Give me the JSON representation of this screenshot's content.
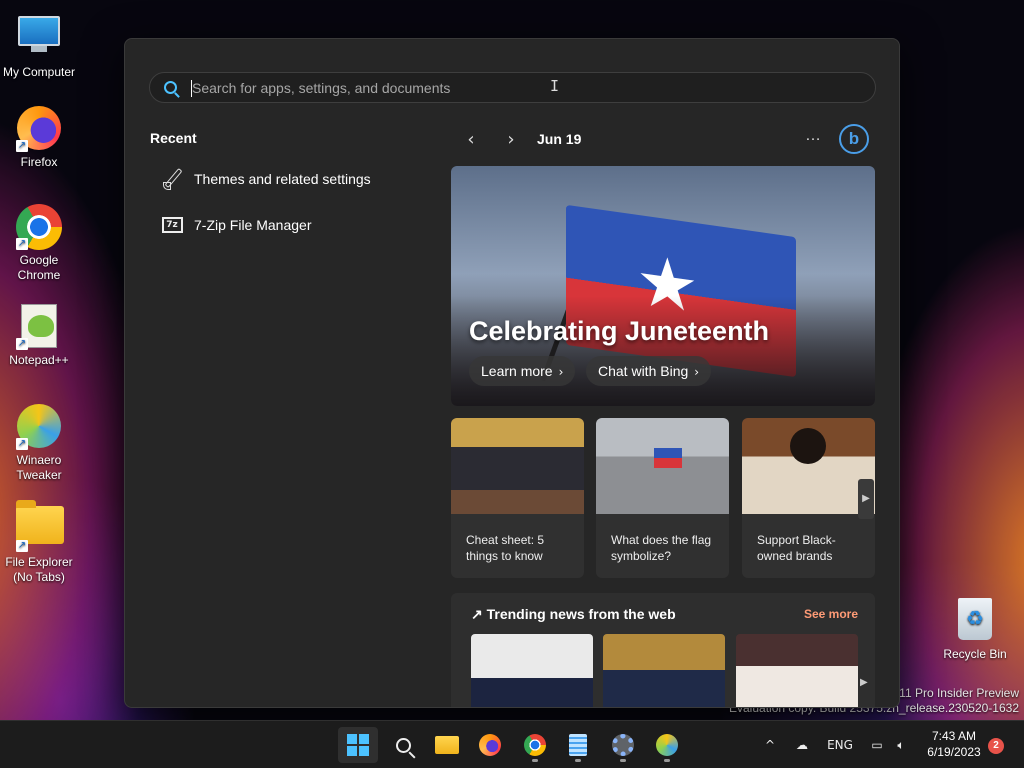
{
  "desktop": {
    "icons": [
      {
        "label": "My Computer"
      },
      {
        "label": "Firefox"
      },
      {
        "label": "Google Chrome"
      },
      {
        "label": "Notepad++"
      },
      {
        "label": "Winaero Tweaker"
      },
      {
        "label": "File Explorer (No Tabs)"
      },
      {
        "label": "Recycle Bin"
      }
    ],
    "watermark": {
      "line1": "s 11 Pro Insider Preview",
      "line2": "Evaluation copy. Build 25375.zn_release.230520-1632"
    }
  },
  "start": {
    "search": {
      "placeholder": "Search for apps, settings, and documents",
      "value": ""
    },
    "recent": {
      "title": "Recent",
      "items": [
        {
          "label": "Themes and related settings",
          "icon": "paintbrush-icon"
        },
        {
          "label": "7-Zip File Manager",
          "icon": "7zip-icon",
          "glyph": "7z"
        }
      ]
    },
    "widgets": {
      "prev": "‹",
      "next": "›",
      "date": "Jun 19",
      "more": "…",
      "bing_glyph": "b",
      "hero": {
        "title": "Celebrating Juneteenth",
        "buttons": [
          "Learn more",
          "Chat with Bing"
        ],
        "chevron": "›"
      },
      "cards": [
        {
          "text": "Cheat sheet: 5 things to know"
        },
        {
          "text": "What does the flag symbolize?"
        },
        {
          "text": "Support Black-owned brands"
        }
      ],
      "card_arrow": "▶",
      "trending": {
        "title": "↗ Trending news from the web",
        "see_more": "See more",
        "arrow": "▶"
      }
    }
  },
  "taskbar": {
    "apps": [
      "start-button",
      "search-button",
      "file-explorer",
      "firefox",
      "chrome",
      "notepad",
      "settings",
      "winaero-tweaker"
    ],
    "tray": {
      "chevron": "^",
      "language": "ENG",
      "time": "7:43 AM",
      "date": "6/19/2023",
      "notifications": "2"
    }
  },
  "colors": {
    "accent": "#4cc2ff",
    "panel": "#262626",
    "see_more": "#ff9b76",
    "notification": "#e8534a"
  }
}
